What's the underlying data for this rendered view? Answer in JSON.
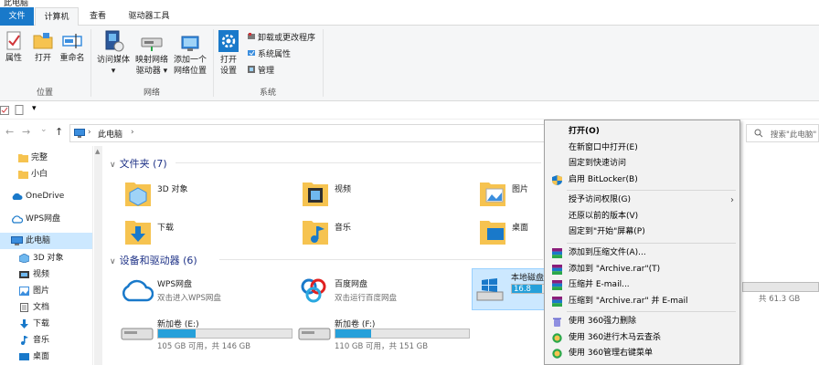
{
  "window": {
    "title": "此电脑"
  },
  "tabs": [
    {
      "label": "文件"
    },
    {
      "label": "计算机"
    },
    {
      "label": "查看"
    },
    {
      "label": "驱动器工具"
    }
  ],
  "ribbon": {
    "location": {
      "label": "位置",
      "buttons": [
        {
          "label": "属性"
        },
        {
          "label": "打开"
        },
        {
          "label": "重命名"
        }
      ]
    },
    "network": {
      "label": "网络",
      "buttons": [
        {
          "label_line1": "访问媒体",
          "label_line2": "▾"
        },
        {
          "label_line1": "映射网络",
          "label_line2": "驱动器 ▾"
        },
        {
          "label_line1": "添加一个",
          "label_line2": "网络位置"
        }
      ]
    },
    "system": {
      "label": "系统",
      "open_settings_line1": "打开",
      "open_settings_line2": "设置",
      "items": [
        {
          "label": "卸载或更改程序"
        },
        {
          "label": "系统属性"
        },
        {
          "label": "管理"
        }
      ]
    }
  },
  "qat": {
    "dropdown": "▾"
  },
  "nav": {
    "back": "←",
    "forward": "→",
    "dropdown": "⌄",
    "up": "↑",
    "breadcrumb_sep": "›",
    "path": "此电脑",
    "path_arrow": "›",
    "search_placeholder": "搜索\"此电脑\""
  },
  "sidebar": {
    "items": [
      {
        "label": "完整"
      },
      {
        "label": "小白"
      },
      {
        "label": "OneDrive"
      },
      {
        "label": "WPS网盘"
      },
      {
        "label": "此电脑"
      },
      {
        "label": "3D 对象"
      },
      {
        "label": "视频"
      },
      {
        "label": "图片"
      },
      {
        "label": "文档"
      },
      {
        "label": "下载"
      },
      {
        "label": "音乐"
      },
      {
        "label": "桌面"
      }
    ]
  },
  "main": {
    "folders_header": "文件夹 (7)",
    "folders": [
      {
        "label": "3D 对象"
      },
      {
        "label": "视频"
      },
      {
        "label": "图片"
      },
      {
        "label": "下载"
      },
      {
        "label": "音乐"
      },
      {
        "label": "桌面"
      }
    ],
    "devices_header": "设备和驱动器 (6)",
    "devices": [
      {
        "name": "WPS网盘",
        "sub": "双击进入WPS网盘"
      },
      {
        "name": "百度网盘",
        "sub": "双击运行百度网盘"
      },
      {
        "name": "本地磁盘",
        "size_text": "16.8",
        "usage": 0.72
      },
      {
        "name": "新加卷 (E:)",
        "size_text": "105 GB 可用，共 146 GB",
        "usage": 0.28
      },
      {
        "name": "新加卷 (F:)",
        "size_text": "110 GB 可用，共 151 GB",
        "usage": 0.27
      },
      {
        "name": "",
        "size_text": "共 61.3 GB",
        "usage": 0.0
      }
    ]
  },
  "context_menu": {
    "items": [
      {
        "label": "打开(O)"
      },
      {
        "label": "在新窗口中打开(E)"
      },
      {
        "label": "固定到快速访问"
      },
      {
        "label": "启用 BitLocker(B)"
      },
      {
        "label": "授予访问权限(G)",
        "submenu": "›"
      },
      {
        "label": "还原以前的版本(V)"
      },
      {
        "label": "固定到\"开始\"屏幕(P)"
      },
      {
        "label": "添加到压缩文件(A)..."
      },
      {
        "label": "添加到 \"Archive.rar\"(T)"
      },
      {
        "label": "压缩并 E-mail..."
      },
      {
        "label": "压缩到 \"Archive.rar\" 并 E-mail"
      },
      {
        "label": "使用 360强力删除"
      },
      {
        "label": "使用 360进行木马云查杀"
      },
      {
        "label": "使用 360管理右键菜单"
      }
    ]
  },
  "colors": {
    "accent": "#1979ca",
    "selection": "#cce8ff",
    "drive_fill": "#26a0da",
    "folder": "#f6c350"
  }
}
